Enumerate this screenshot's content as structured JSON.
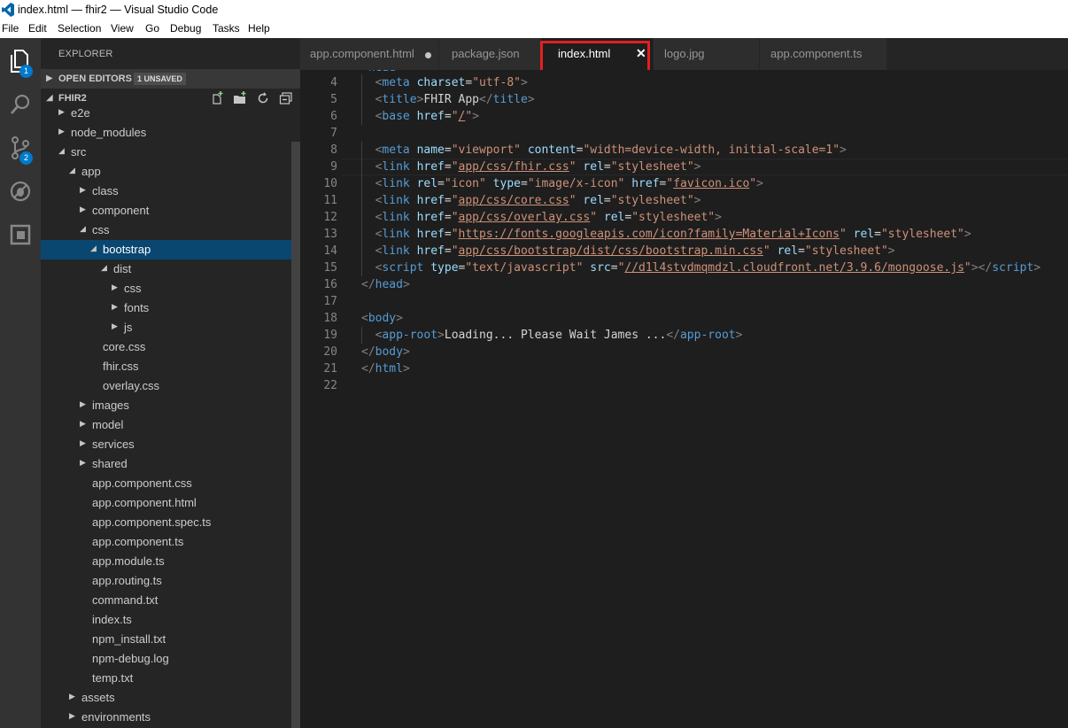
{
  "window": {
    "title": "index.html — fhir2 — Visual Studio Code"
  },
  "menu": [
    "File",
    "Edit",
    "Selection",
    "View",
    "Go",
    "Debug",
    "Tasks",
    "Help"
  ],
  "activity": [
    {
      "icon": "explorer-icon",
      "badge": "1"
    },
    {
      "icon": "search-icon",
      "badge": ""
    },
    {
      "icon": "source-control-icon",
      "badge": "2"
    },
    {
      "icon": "debug-icon",
      "badge": ""
    },
    {
      "icon": "extensions-icon",
      "badge": ""
    }
  ],
  "sidebar": {
    "title": "EXPLORER",
    "open_editors": {
      "label": "OPEN EDITORS",
      "badge": "1 UNSAVED"
    },
    "project": {
      "label": "FHIR2"
    },
    "tree": [
      {
        "name": "e2e",
        "depth": 1,
        "twisty": "closed"
      },
      {
        "name": "node_modules",
        "depth": 1,
        "twisty": "closed"
      },
      {
        "name": "src",
        "depth": 1,
        "twisty": "open"
      },
      {
        "name": "app",
        "depth": 2,
        "twisty": "open"
      },
      {
        "name": "class",
        "depth": 3,
        "twisty": "closed"
      },
      {
        "name": "component",
        "depth": 3,
        "twisty": "closed"
      },
      {
        "name": "css",
        "depth": 3,
        "twisty": "open"
      },
      {
        "name": "bootstrap",
        "depth": 4,
        "twisty": "open",
        "selected": true
      },
      {
        "name": "dist",
        "depth": 5,
        "twisty": "open"
      },
      {
        "name": "css",
        "depth": 6,
        "twisty": "closed"
      },
      {
        "name": "fonts",
        "depth": 6,
        "twisty": "closed"
      },
      {
        "name": "js",
        "depth": 6,
        "twisty": "closed"
      },
      {
        "name": "core.css",
        "depth": 4,
        "twisty": "none"
      },
      {
        "name": "fhir.css",
        "depth": 4,
        "twisty": "none"
      },
      {
        "name": "overlay.css",
        "depth": 4,
        "twisty": "none"
      },
      {
        "name": "images",
        "depth": 3,
        "twisty": "closed"
      },
      {
        "name": "model",
        "depth": 3,
        "twisty": "closed"
      },
      {
        "name": "services",
        "depth": 3,
        "twisty": "closed"
      },
      {
        "name": "shared",
        "depth": 3,
        "twisty": "closed"
      },
      {
        "name": "app.component.css",
        "depth": 3,
        "twisty": "none"
      },
      {
        "name": "app.component.html",
        "depth": 3,
        "twisty": "none"
      },
      {
        "name": "app.component.spec.ts",
        "depth": 3,
        "twisty": "none"
      },
      {
        "name": "app.component.ts",
        "depth": 3,
        "twisty": "none"
      },
      {
        "name": "app.module.ts",
        "depth": 3,
        "twisty": "none"
      },
      {
        "name": "app.routing.ts",
        "depth": 3,
        "twisty": "none"
      },
      {
        "name": "command.txt",
        "depth": 3,
        "twisty": "none"
      },
      {
        "name": "index.ts",
        "depth": 3,
        "twisty": "none"
      },
      {
        "name": "npm_install.txt",
        "depth": 3,
        "twisty": "none"
      },
      {
        "name": "npm-debug.log",
        "depth": 3,
        "twisty": "none"
      },
      {
        "name": "temp.txt",
        "depth": 3,
        "twisty": "none"
      },
      {
        "name": "assets",
        "depth": 2,
        "twisty": "closed"
      },
      {
        "name": "environments",
        "depth": 2,
        "twisty": "closed"
      }
    ]
  },
  "tabs": [
    {
      "label": "app.component.html",
      "state": "dirty"
    },
    {
      "label": "package.json",
      "state": "normal"
    },
    {
      "label": "index.html",
      "state": "active"
    },
    {
      "label": "logo.jpg",
      "state": "normal"
    },
    {
      "label": "app.component.ts",
      "state": "normal"
    }
  ],
  "editor": {
    "lines": [
      {
        "n": "4",
        "indent": 1,
        "tokens": [
          [
            "p",
            "<"
          ],
          [
            "t",
            "meta"
          ],
          [
            "d",
            " "
          ],
          [
            "a",
            "charset"
          ],
          [
            "d",
            "="
          ],
          [
            "s",
            "\"utf-8\""
          ],
          [
            "p",
            ">"
          ]
        ]
      },
      {
        "n": "5",
        "indent": 1,
        "tokens": [
          [
            "p",
            "<"
          ],
          [
            "t",
            "title"
          ],
          [
            "p",
            ">"
          ],
          [
            "d",
            "FHIR App"
          ],
          [
            "p",
            "</"
          ],
          [
            "t",
            "title"
          ],
          [
            "p",
            ">"
          ]
        ]
      },
      {
        "n": "6",
        "indent": 1,
        "tokens": [
          [
            "p",
            "<"
          ],
          [
            "t",
            "base"
          ],
          [
            "d",
            " "
          ],
          [
            "a",
            "href"
          ],
          [
            "d",
            "="
          ],
          [
            "s",
            "\""
          ],
          [
            "u",
            "/"
          ],
          [
            "s",
            "\""
          ],
          [
            "p",
            ">"
          ]
        ]
      },
      {
        "n": "7",
        "indent": 0,
        "tokens": []
      },
      {
        "n": "8",
        "indent": 1,
        "tokens": [
          [
            "p",
            "<"
          ],
          [
            "t",
            "meta"
          ],
          [
            "d",
            " "
          ],
          [
            "a",
            "name"
          ],
          [
            "d",
            "="
          ],
          [
            "s",
            "\"viewport\""
          ],
          [
            "d",
            " "
          ],
          [
            "a",
            "content"
          ],
          [
            "d",
            "="
          ],
          [
            "s",
            "\"width=device-width, initial-scale=1\""
          ],
          [
            "p",
            ">"
          ]
        ]
      },
      {
        "n": "9",
        "indent": 1,
        "current": true,
        "tokens": [
          [
            "p",
            "<"
          ],
          [
            "t",
            "link"
          ],
          [
            "d",
            " "
          ],
          [
            "a",
            "href"
          ],
          [
            "d",
            "="
          ],
          [
            "s",
            "\""
          ],
          [
            "u",
            "app/css/fhir.css"
          ],
          [
            "s",
            "\""
          ],
          [
            "d",
            " "
          ],
          [
            "a",
            "rel"
          ],
          [
            "d",
            "="
          ],
          [
            "s",
            "\"stylesheet\""
          ],
          [
            "p",
            ">"
          ]
        ]
      },
      {
        "n": "10",
        "indent": 1,
        "tokens": [
          [
            "p",
            "<"
          ],
          [
            "t",
            "link"
          ],
          [
            "d",
            " "
          ],
          [
            "a",
            "rel"
          ],
          [
            "d",
            "="
          ],
          [
            "s",
            "\"icon\""
          ],
          [
            "d",
            " "
          ],
          [
            "a",
            "type"
          ],
          [
            "d",
            "="
          ],
          [
            "s",
            "\"image/x-icon\""
          ],
          [
            "d",
            " "
          ],
          [
            "a",
            "href"
          ],
          [
            "d",
            "="
          ],
          [
            "s",
            "\""
          ],
          [
            "u",
            "favicon.ico"
          ],
          [
            "s",
            "\""
          ],
          [
            "p",
            ">"
          ]
        ]
      },
      {
        "n": "11",
        "indent": 1,
        "tokens": [
          [
            "p",
            "<"
          ],
          [
            "t",
            "link"
          ],
          [
            "d",
            " "
          ],
          [
            "a",
            "href"
          ],
          [
            "d",
            "="
          ],
          [
            "s",
            "\""
          ],
          [
            "u",
            "app/css/core.css"
          ],
          [
            "s",
            "\""
          ],
          [
            "d",
            " "
          ],
          [
            "a",
            "rel"
          ],
          [
            "d",
            "="
          ],
          [
            "s",
            "\"stylesheet\""
          ],
          [
            "p",
            ">"
          ]
        ]
      },
      {
        "n": "12",
        "indent": 1,
        "tokens": [
          [
            "p",
            "<"
          ],
          [
            "t",
            "link"
          ],
          [
            "d",
            " "
          ],
          [
            "a",
            "href"
          ],
          [
            "d",
            "="
          ],
          [
            "s",
            "\""
          ],
          [
            "u",
            "app/css/overlay.css"
          ],
          [
            "s",
            "\""
          ],
          [
            "d",
            " "
          ],
          [
            "a",
            "rel"
          ],
          [
            "d",
            "="
          ],
          [
            "s",
            "\"stylesheet\""
          ],
          [
            "p",
            ">"
          ]
        ]
      },
      {
        "n": "13",
        "indent": 1,
        "tokens": [
          [
            "p",
            "<"
          ],
          [
            "t",
            "link"
          ],
          [
            "d",
            " "
          ],
          [
            "a",
            "href"
          ],
          [
            "d",
            "="
          ],
          [
            "s",
            "\""
          ],
          [
            "u",
            "https://fonts.googleapis.com/icon?family=Material+Icons"
          ],
          [
            "s",
            "\""
          ],
          [
            "d",
            " "
          ],
          [
            "a",
            "rel"
          ],
          [
            "d",
            "="
          ],
          [
            "s",
            "\"stylesheet\""
          ],
          [
            "p",
            ">"
          ]
        ]
      },
      {
        "n": "14",
        "indent": 1,
        "tokens": [
          [
            "p",
            "<"
          ],
          [
            "t",
            "link"
          ],
          [
            "d",
            " "
          ],
          [
            "a",
            "href"
          ],
          [
            "d",
            "="
          ],
          [
            "s",
            "\""
          ],
          [
            "u",
            "app/css/bootstrap/dist/css/bootstrap.min.css"
          ],
          [
            "s",
            "\""
          ],
          [
            "d",
            " "
          ],
          [
            "a",
            "rel"
          ],
          [
            "d",
            "="
          ],
          [
            "s",
            "\"stylesheet\""
          ],
          [
            "p",
            ">"
          ]
        ]
      },
      {
        "n": "15",
        "indent": 1,
        "tokens": [
          [
            "p",
            "<"
          ],
          [
            "t",
            "script"
          ],
          [
            "d",
            " "
          ],
          [
            "a",
            "type"
          ],
          [
            "d",
            "="
          ],
          [
            "s",
            "\"text/javascript\""
          ],
          [
            "d",
            " "
          ],
          [
            "a",
            "src"
          ],
          [
            "d",
            "="
          ],
          [
            "s",
            "\""
          ],
          [
            "u",
            "//d1l4stvdmqmdzl.cloudfront.net/3.9.6/mongoose.js"
          ],
          [
            "s",
            "\""
          ],
          [
            "p",
            "></"
          ],
          [
            "t",
            "script"
          ],
          [
            "p",
            ">"
          ]
        ]
      },
      {
        "n": "16",
        "indent": 0,
        "tokens": [
          [
            "p",
            "</"
          ],
          [
            "t",
            "head"
          ],
          [
            "p",
            ">"
          ]
        ]
      },
      {
        "n": "17",
        "indent": 0,
        "tokens": []
      },
      {
        "n": "18",
        "indent": 0,
        "tokens": [
          [
            "p",
            "<"
          ],
          [
            "t",
            "body"
          ],
          [
            "p",
            ">"
          ]
        ]
      },
      {
        "n": "19",
        "indent": 1,
        "tokens": [
          [
            "p",
            "<"
          ],
          [
            "t",
            "app-root"
          ],
          [
            "p",
            ">"
          ],
          [
            "d",
            "Loading... Please Wait James ..."
          ],
          [
            "p",
            "</"
          ],
          [
            "t",
            "app-root"
          ],
          [
            "p",
            ">"
          ]
        ]
      },
      {
        "n": "20",
        "indent": 0,
        "tokens": [
          [
            "p",
            "</"
          ],
          [
            "t",
            "body"
          ],
          [
            "p",
            ">"
          ]
        ]
      },
      {
        "n": "21",
        "indent": 0,
        "tokens": [
          [
            "p",
            "</"
          ],
          [
            "t",
            "html"
          ],
          [
            "p",
            ">"
          ]
        ]
      },
      {
        "n": "22",
        "indent": 0,
        "tokens": []
      }
    ]
  }
}
